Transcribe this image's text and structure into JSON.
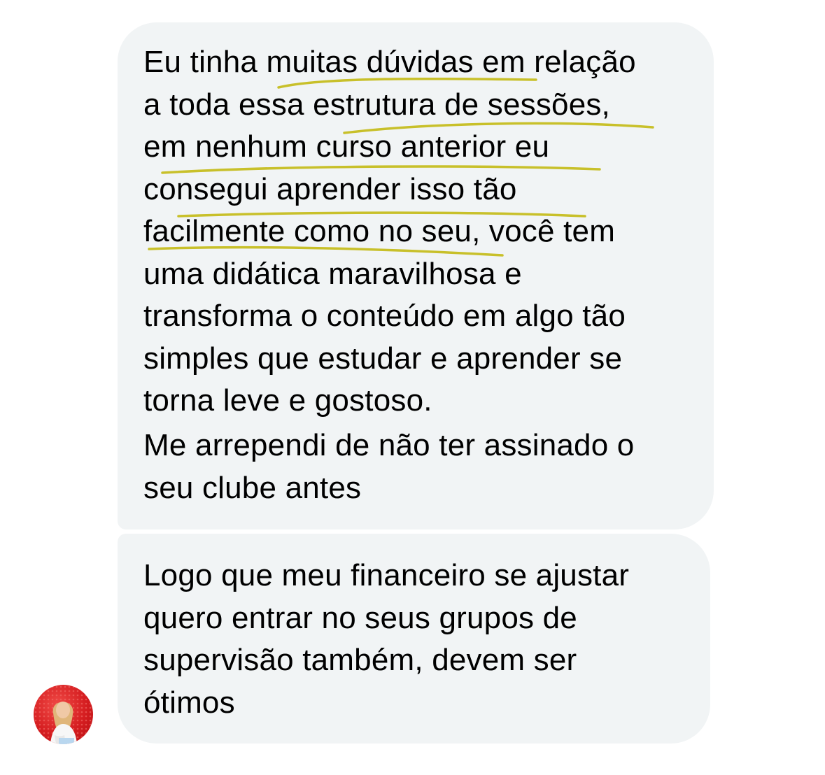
{
  "messages": [
    {
      "paragraphs": [
        "Eu tinha muitas dúvidas em relação\na toda essa estrutura de sessões,\nem nenhum curso anterior eu\nconsegui aprender isso tão\nfacilmente como no seu, você tem\numa didática maravilhosa e\ntransforma o conteúdo em algo tão\nsimples que estudar e aprender se\ntorna leve e gostoso.",
        "Me arrependi de não ter assinado o\nseu clube antes"
      ]
    },
    {
      "paragraphs": [
        "Logo que meu financeiro se ajustar\nquero entrar no seus grupos de\nsupervisão também, devem ser\nótimos"
      ]
    }
  ],
  "colors": {
    "bubble_background": "#f1f4f5",
    "text": "#1c1c1e",
    "highlight_underline": "#c8c02a",
    "avatar_background": "#d51d20"
  },
  "icons": {
    "avatar": "profile-photo-avatar",
    "annotation": "handwritten-yellow-underlines"
  }
}
